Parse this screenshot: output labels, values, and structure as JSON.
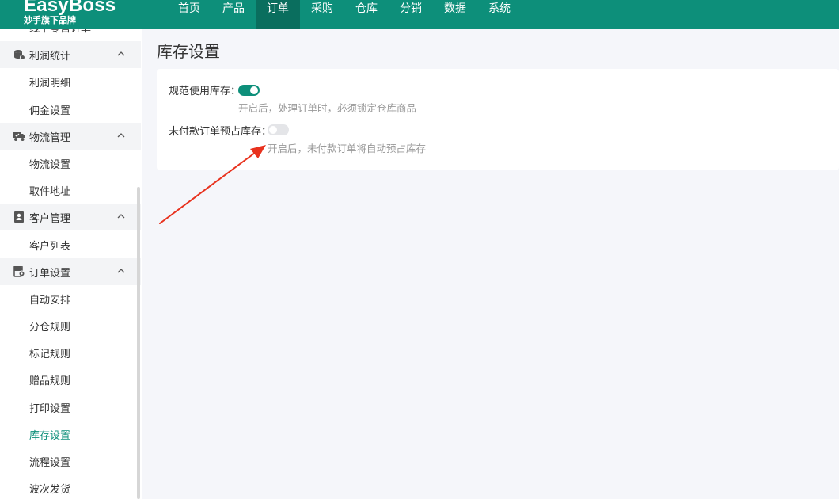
{
  "header": {
    "logo_main": "EasyBoss",
    "logo_sub": "妙手旗下品牌",
    "nav": [
      "首页",
      "产品",
      "订单",
      "采购",
      "仓库",
      "分销",
      "数据",
      "系统"
    ],
    "active_nav": "订单"
  },
  "sidebar": {
    "cut_item": "线下零售订单",
    "groups": [
      {
        "label": "利润统计",
        "icon": "database-icon",
        "items": [
          "利润明细",
          "佣金设置"
        ]
      },
      {
        "label": "物流管理",
        "icon": "truck-icon",
        "items": [
          "物流设置",
          "取件地址"
        ]
      },
      {
        "label": "客户管理",
        "icon": "customer-icon",
        "items": [
          "客户列表"
        ]
      },
      {
        "label": "订单设置",
        "icon": "order-settings-icon",
        "items": [
          "自动安排",
          "分仓规则",
          "标记规则",
          "赠品规则",
          "打印设置",
          "库存设置",
          "流程设置",
          "波次发货"
        ]
      }
    ],
    "active_item": "库存设置"
  },
  "main": {
    "title": "库存设置",
    "settings": [
      {
        "label": "规范使用库存：",
        "enabled": true,
        "hint": "开启后，处理订单时，必须锁定仓库商品"
      },
      {
        "label": "未付款订单预占库存：",
        "enabled": false,
        "hint": "开启后，未付款订单将自动预占库存"
      }
    ]
  },
  "colors": {
    "brand": "#0d8f7a",
    "brand_dark": "#0a6e5e",
    "annotation_arrow": "#e8321e"
  }
}
